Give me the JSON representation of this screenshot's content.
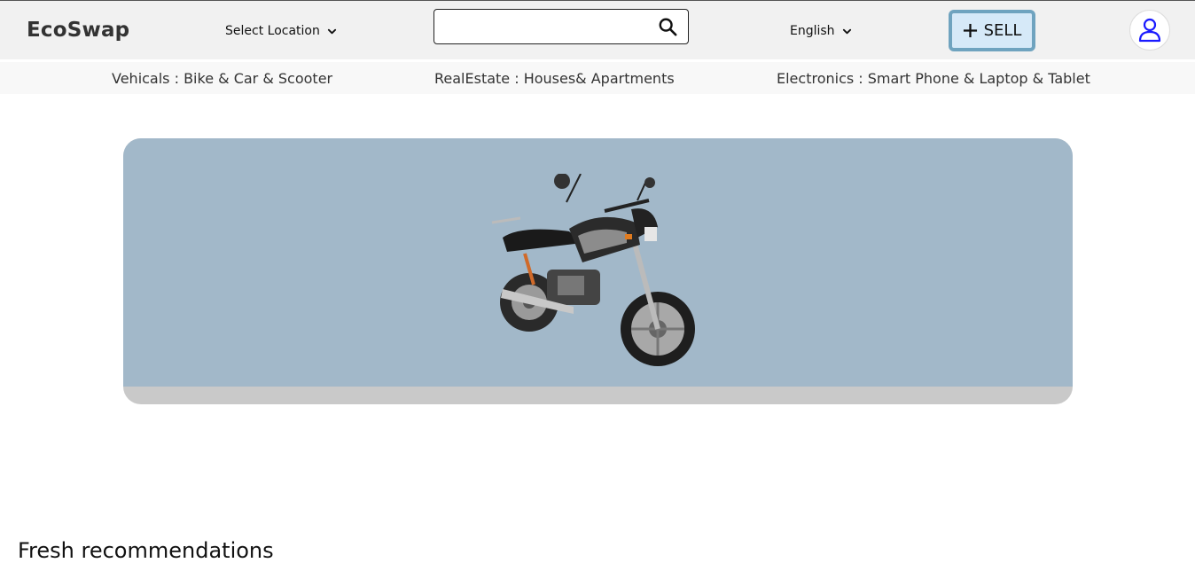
{
  "header": {
    "logo": "EcoSwap",
    "location_label": "Select Location",
    "search": {
      "value": "",
      "placeholder": ""
    },
    "language_label": "English",
    "sell_label": "SELL"
  },
  "categories": [
    "Vehicals : Bike & Car & Scooter",
    "RealEstate : Houses& Apartments",
    "Electronics : Smart Phone & Laptop & Tablet"
  ],
  "banner": {
    "image": "motorcycle"
  },
  "section": {
    "title": "Fresh recommendations"
  },
  "icons": {
    "location": "chevron-down-icon",
    "search": "search-icon",
    "language": "chevron-down-icon",
    "sell": "plus-icon",
    "profile": "user-icon"
  },
  "colors": {
    "sell_bg": "#d6e9f8",
    "sell_border": "#6fa3bf",
    "banner_bg": "#a2b8c9",
    "avatar_icon": "#1a1aff"
  }
}
